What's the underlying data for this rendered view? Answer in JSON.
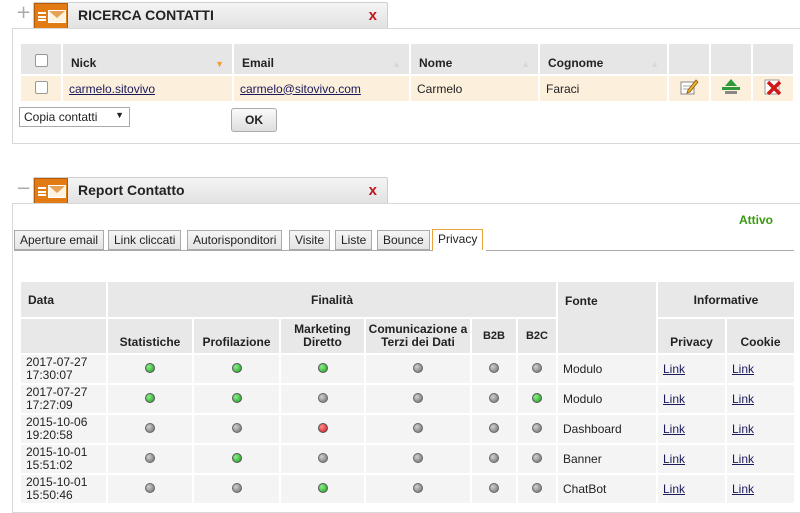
{
  "panel1": {
    "toggle": "+",
    "title": "RICERCA CONTATTI",
    "close": "x",
    "columns": [
      "Nick",
      "Email",
      "Nome",
      "Cognome"
    ],
    "row": {
      "nick": "carmelo.sitovivo",
      "email": "carmelo@sitovivo.com",
      "nome": "Carmelo",
      "cognome": "Faraci"
    },
    "select_value": "Copia contatti",
    "ok_label": "OK"
  },
  "panel2": {
    "toggle": "−",
    "title": "Report Contatto",
    "close": "x",
    "status": "Attivo",
    "tabs": [
      "Aperture email",
      "Link cliccati",
      "Autorisponditori",
      "Visite",
      "Liste",
      "Bounce",
      "Privacy"
    ],
    "headers": {
      "data": "Data",
      "finalita": "Finalità",
      "fonte": "Fonte",
      "informative": "Informative",
      "statistiche": "Statistiche",
      "profilazione": "Profilazione",
      "marketing": "Marketing Diretto",
      "comunicazione": "Comunicazione a Terzi dei Dati",
      "b2b": "B2B",
      "b2c": "B2C",
      "privacy": "Privacy",
      "cookie": "Cookie"
    },
    "rows": [
      {
        "date": "2017-07-27",
        "time": "17:30:07",
        "flags": [
          "green",
          "green",
          "green",
          "grey",
          "grey",
          "grey"
        ],
        "fonte": "Modulo",
        "privacy": "Link",
        "cookie": "Link"
      },
      {
        "date": "2017-07-27",
        "time": "17:27:09",
        "flags": [
          "green",
          "green",
          "grey",
          "grey",
          "grey",
          "green"
        ],
        "fonte": "Modulo",
        "privacy": "Link",
        "cookie": "Link"
      },
      {
        "date": "2015-10-06",
        "time": "19:20:58",
        "flags": [
          "grey",
          "grey",
          "red",
          "grey",
          "grey",
          "grey"
        ],
        "fonte": "Dashboard",
        "privacy": "Link",
        "cookie": "Link"
      },
      {
        "date": "2015-10-01",
        "time": "15:51:02",
        "flags": [
          "grey",
          "green",
          "grey",
          "grey",
          "grey",
          "grey"
        ],
        "fonte": "Banner",
        "privacy": "Link",
        "cookie": "Link"
      },
      {
        "date": "2015-10-01",
        "time": "15:50:46",
        "flags": [
          "grey",
          "grey",
          "green",
          "grey",
          "grey",
          "grey"
        ],
        "fonte": "ChatBot",
        "privacy": "Link",
        "cookie": "Link"
      }
    ]
  }
}
